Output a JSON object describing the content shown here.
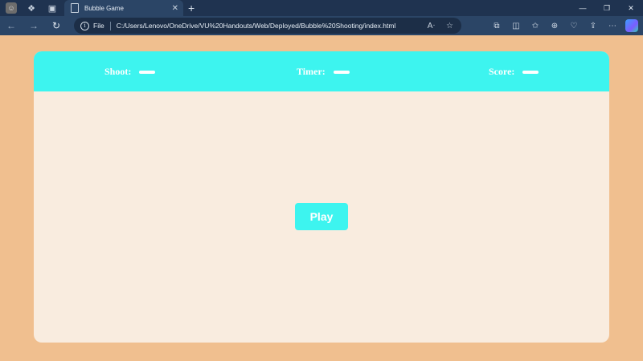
{
  "browser": {
    "tab": {
      "title": "Bubble Game",
      "close": "✕"
    },
    "new_tab": "+",
    "window_controls": {
      "minimize": "—",
      "restore": "❐",
      "close": "✕"
    },
    "nav": {
      "back": "←",
      "forward": "→",
      "refresh": "↻"
    },
    "address": {
      "info": "i",
      "scheme_label": "File",
      "url": "C:/Users/Lenovo/OneDrive/VU%20Handouts/Web/Deployed/Bubble%20Shooting/index.html"
    },
    "icons": [
      "read-aloud-icon",
      "favorite-star-icon",
      "extensions-icon",
      "split-screen-icon",
      "favorites-icon",
      "collections-icon",
      "browser-essentials-icon",
      "share-icon",
      "more-icon",
      "copilot-icon"
    ]
  },
  "game": {
    "hud": {
      "shoot_label": "Shoot:",
      "timer_label": "Timer:",
      "score_label": "Score:"
    },
    "play_label": "Play",
    "colors": {
      "page_background": "#f0bf8f",
      "game_background": "#f9ecdf",
      "accent": "#3df4ef",
      "text": "#ffffff"
    }
  }
}
